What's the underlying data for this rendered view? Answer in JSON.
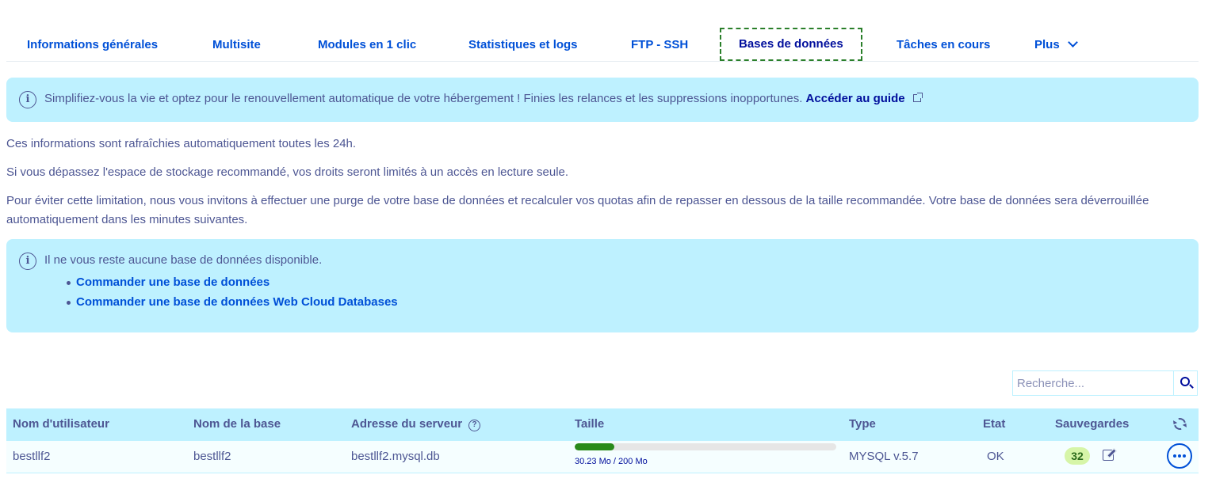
{
  "tabs": [
    {
      "label": "Informations générales"
    },
    {
      "label": "Multisite"
    },
    {
      "label": "Modules en 1 clic"
    },
    {
      "label": "Statistiques et logs"
    },
    {
      "label": "FTP - SSH"
    },
    {
      "label": "Bases de données",
      "active": true
    },
    {
      "label": "Tâches en cours"
    },
    {
      "label": "Plus"
    }
  ],
  "banner": {
    "text": "Simplifiez-vous la vie et optez pour le renouvellement automatique de votre hébergement ! Finies les relances et les suppressions inopportunes.",
    "link": "Accéder au guide"
  },
  "paragraphs": [
    "Ces informations sont rafraîchies automatiquement toutes les 24h.",
    "Si vous dépassez l'espace de stockage recommandé, vos droits seront limités à un accès en lecture seule.",
    "Pour éviter cette limitation, nous vous invitons à effectuer une purge de votre base de données et recalculer vos quotas afin de repasser en dessous de la taille recommandée. Votre base de données sera déverrouillée automatiquement dans les minutes suivantes."
  ],
  "notice": {
    "text": "Il ne vous reste aucune base de données disponible.",
    "links": [
      "Commander une base de données",
      "Commander une base de données Web Cloud Databases"
    ]
  },
  "search": {
    "placeholder": "Recherche..."
  },
  "table": {
    "headers": {
      "user": "Nom d'utilisateur",
      "dbname": "Nom de la base",
      "server": "Adresse du serveur",
      "size": "Taille",
      "type": "Type",
      "state": "Etat",
      "backups": "Sauvegardes"
    },
    "rows": [
      {
        "user": "bestllf2",
        "dbname": "bestllf2",
        "server": "bestllf2.mysql.db",
        "size_label": "30.23 Mo / 200 Mo",
        "size_fraction": 0.1512,
        "type": "MYSQL v.5.7",
        "state": "OK",
        "backups": "32"
      }
    ]
  },
  "colors": {
    "accent": "#0050d7",
    "banner_bg": "#bef1ff",
    "progress": "#2a8a1a"
  },
  "icons": [
    "info-icon",
    "external-link-icon",
    "chevron-down-icon",
    "search-icon",
    "question-icon",
    "refresh-icon",
    "edit-icon",
    "more-icon"
  ]
}
